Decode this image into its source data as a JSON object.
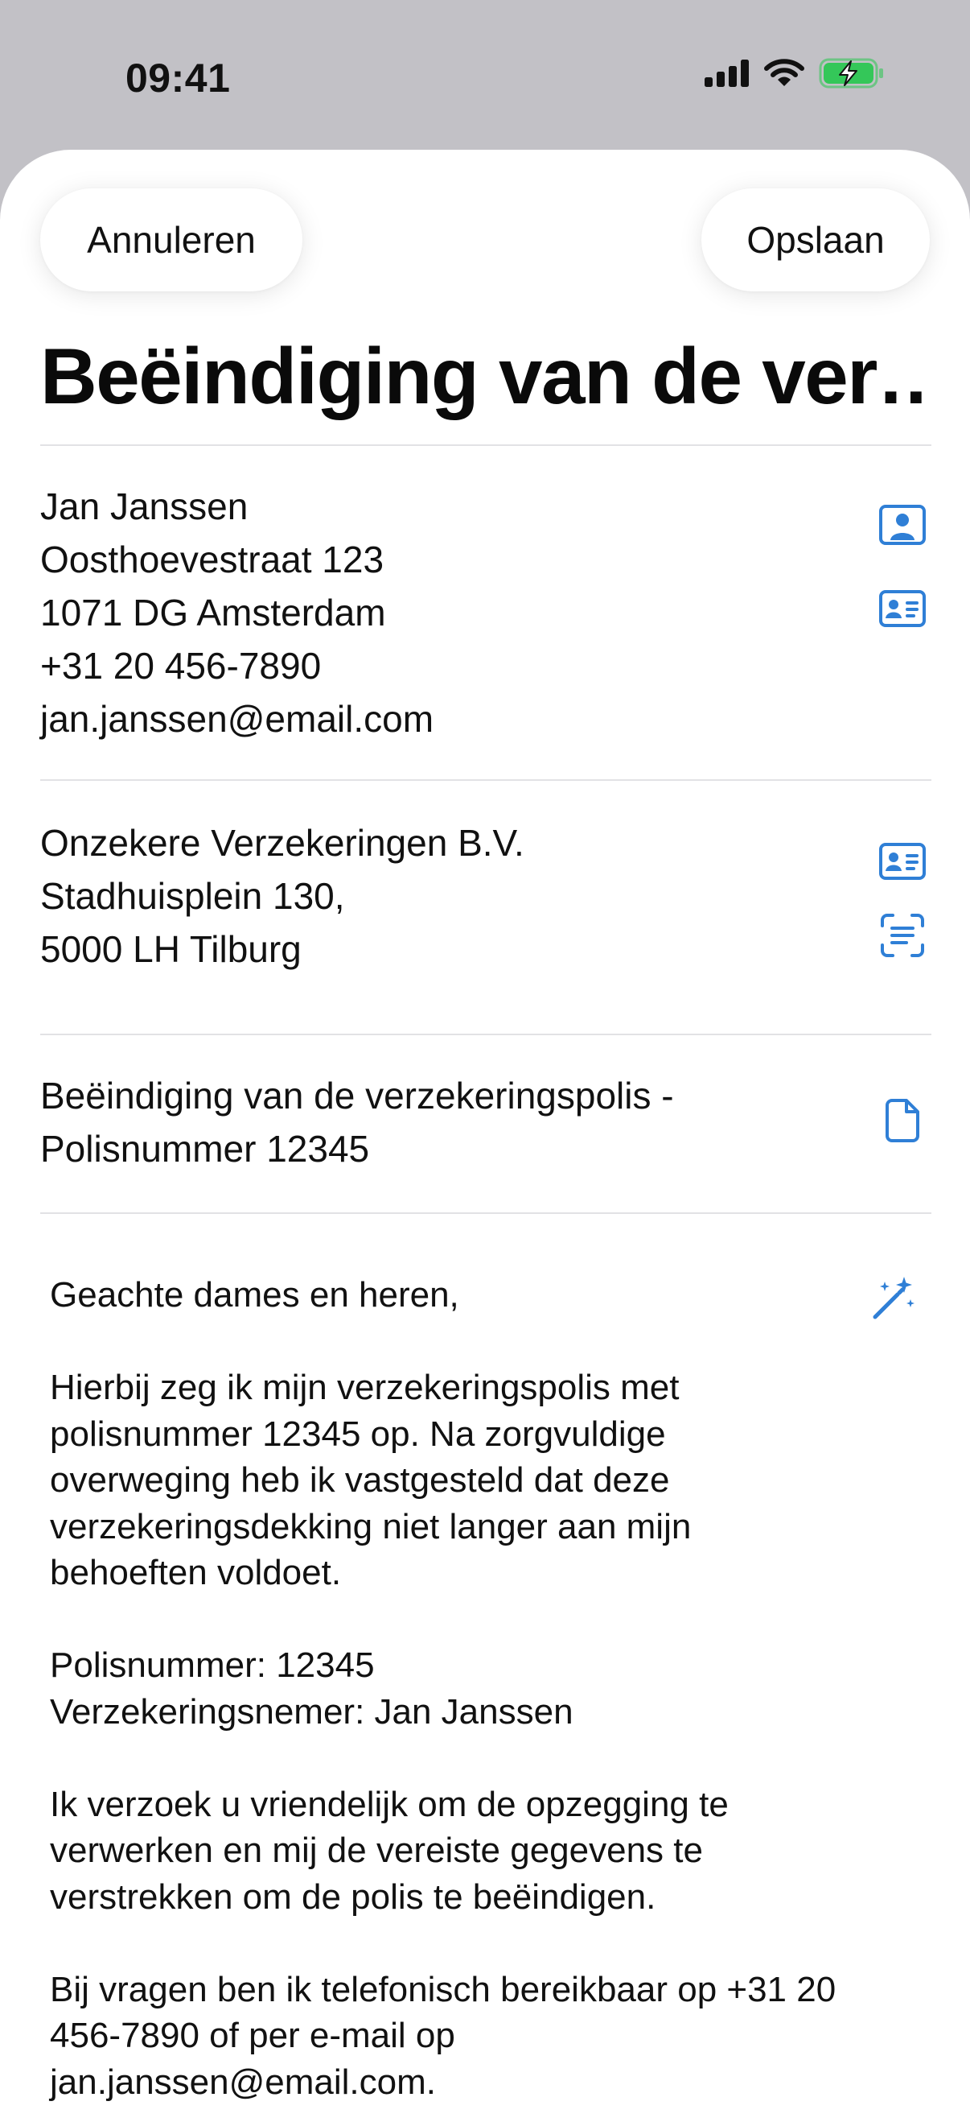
{
  "status_bar": {
    "time": "09:41",
    "icons": [
      "cellular-signal-icon",
      "wifi-icon",
      "battery-charging-icon"
    ]
  },
  "header": {
    "cancel_label": "Annuleren",
    "save_label": "Opslaan",
    "title": "Beëindiging van de ver…"
  },
  "sender": {
    "name": "Jan Janssen",
    "street": "Oosthoevestraat 123",
    "city": "1071 DG Amsterdam",
    "phone": "+31 20 456-7890",
    "email": "jan.janssen@email.com",
    "icons": [
      "person-square-icon",
      "contact-card-icon"
    ]
  },
  "recipient": {
    "company": "Onzekere Verzekeringen B.V.",
    "street": "Stadhuisplein 130,",
    "city": "5000 LH Tilburg",
    "icons": [
      "contact-card-icon",
      "scan-text-icon"
    ]
  },
  "subject": {
    "line1": "Beëindiging van de verzekeringspolis -",
    "line2": "Polisnummer 12345",
    "icon": "document-icon"
  },
  "letter": {
    "icon": "magic-wand-icon",
    "body": "Geachte dames en heren,\n\nHierbij zeg ik mijn verzekeringspolis met\npolisnummer 12345 op. Na zorgvuldige\noverweging heb ik vastgesteld dat deze\nverzekeringsdekking niet langer aan mijn\nbehoeften voldoet.\n\nPolisnummer: 12345\nVerzekeringsnemer: Jan Janssen\n\nIk verzoek u vriendelijk om de opzegging te\nverwerken en mij de vereiste gegevens te\nverstrekken om de polis te beëindigen.\n\nBij vragen ben ik telefonisch bereikbaar op +31 20\n456-7890 of per e-mail op\njan.janssen@email.com."
  },
  "colors": {
    "accent": "#2f7fd6",
    "battery": "#34c759",
    "divider": "#e2e2e5",
    "backdrop": "#c2c1c6"
  }
}
